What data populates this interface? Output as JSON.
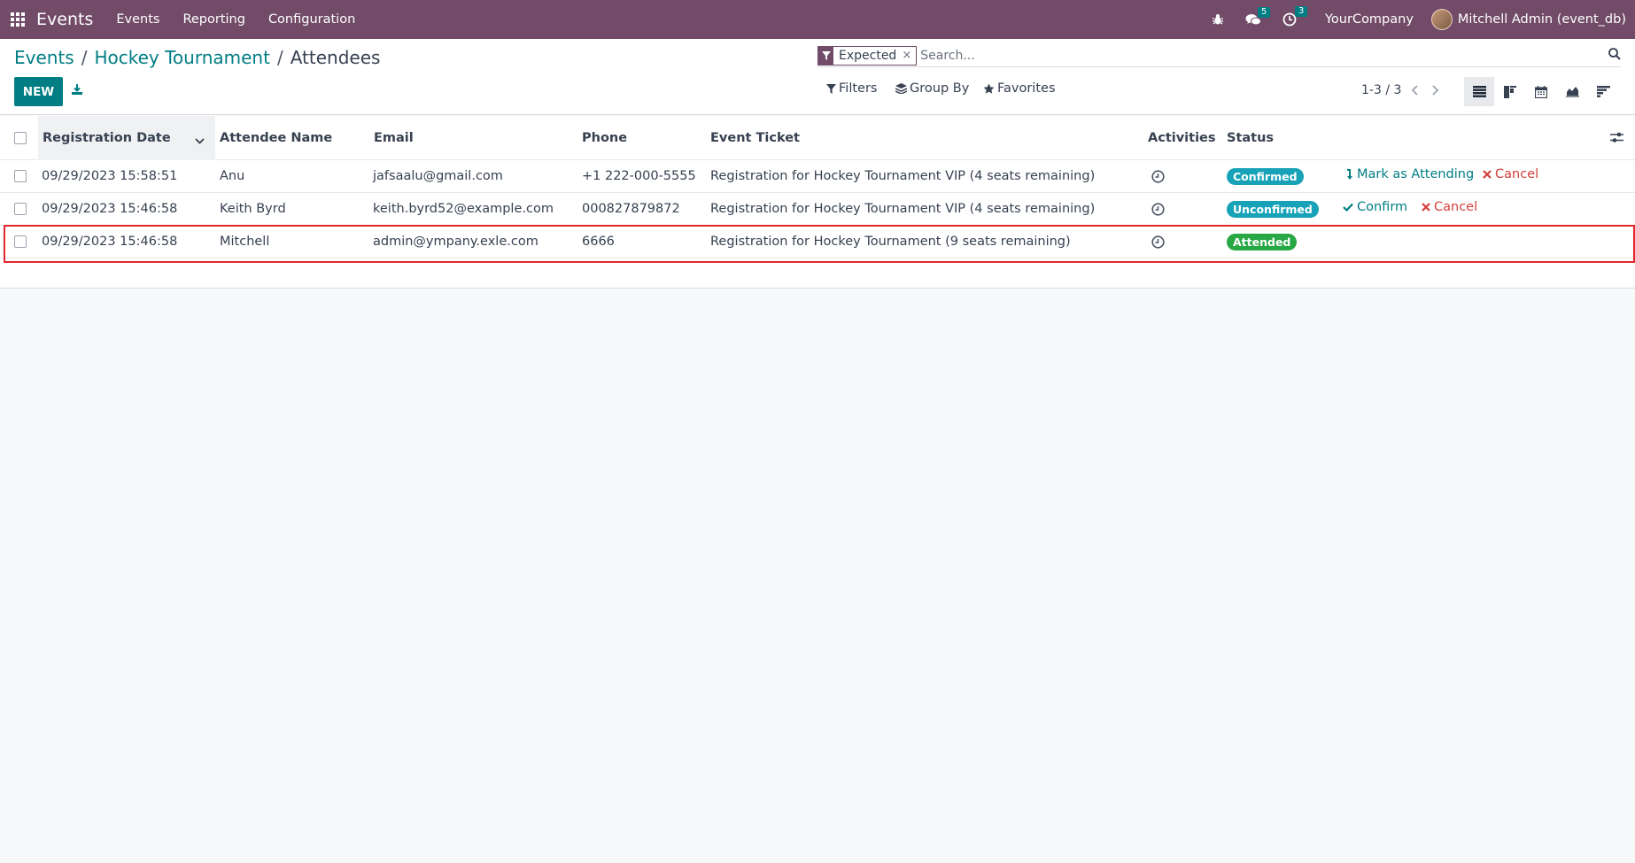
{
  "navbar": {
    "app_name": "Events",
    "menus": [
      "Events",
      "Reporting",
      "Configuration"
    ],
    "messages_count": "5",
    "activities_count": "3",
    "company": "YourCompany",
    "user": "Mitchell Admin (event_db)"
  },
  "breadcrumb": {
    "items": [
      "Events",
      "Hockey Tournament"
    ],
    "current": "Attendees"
  },
  "toolbar": {
    "new_label": "NEW"
  },
  "search": {
    "facet_value": "Expected",
    "facet_remove": "×",
    "placeholder": "Search..."
  },
  "filters": {
    "filters_label": "Filters",
    "group_by_label": "Group By",
    "favorites_label": "Favorites"
  },
  "pager": {
    "value": "1-3 / 3"
  },
  "table": {
    "columns": [
      "Registration Date",
      "Attendee Name",
      "Email",
      "Phone",
      "Event Ticket",
      "Activities",
      "Status"
    ],
    "rows": [
      {
        "date": "09/29/2023 15:58:51",
        "name": "Anu",
        "email": "jafsaalu@gmail.com",
        "phone": "+1 222-000-5555",
        "ticket": "Registration for Hockey Tournament VIP (4 seats remaining)",
        "status": "Confirmed",
        "actions": [
          "Mark as Attending",
          "Cancel"
        ]
      },
      {
        "date": "09/29/2023 15:46:58",
        "name": "Keith Byrd",
        "email": "keith.byrd52@example.com",
        "phone": "000827879872",
        "ticket": "Registration for Hockey Tournament VIP (4 seats remaining)",
        "status": "Unconfirmed",
        "actions": [
          "Confirm",
          "Cancel"
        ]
      },
      {
        "date": "09/29/2023 15:46:58",
        "name": "Mitchell",
        "email": "admin@ympany.exle.com",
        "phone": "6666",
        "ticket": "Registration for Hockey Tournament (9 seats remaining)",
        "status": "Attended",
        "actions": []
      }
    ]
  },
  "colors": {
    "brand": "#714b67",
    "accent": "#017e84",
    "status_info": "#17a2b8",
    "status_success": "#28a745",
    "danger": "#d23f3a",
    "highlight": "#e3262b"
  },
  "icons": [
    "apps-icon",
    "bug-icon",
    "chat-icon",
    "clock-icon",
    "avatar",
    "download-icon",
    "filter-icon",
    "layers-icon",
    "star-icon",
    "search-icon",
    "list-view-icon",
    "kanban-view-icon",
    "calendar-view-icon",
    "graph-view-icon",
    "gantt-view-icon",
    "settings-sliders-icon",
    "chevron-down-icon"
  ]
}
